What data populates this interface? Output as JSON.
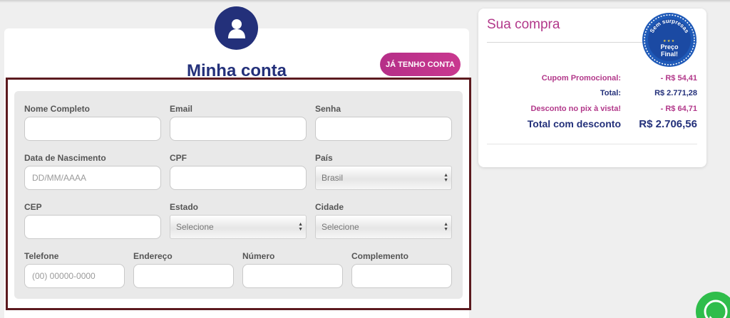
{
  "account": {
    "title": "Minha conta",
    "have_account_button": "JÁ TENHO CONTA"
  },
  "form": {
    "full_name_label": "Nome Completo",
    "email_label": "Email",
    "password_label": "Senha",
    "birthdate_label": "Data de Nascimento",
    "birthdate_placeholder": "DD/MM/AAAA",
    "cpf_label": "CPF",
    "country_label": "País",
    "country_value": "Brasil",
    "cep_label": "CEP",
    "state_label": "Estado",
    "state_value": "Selecione",
    "city_label": "Cidade",
    "city_value": "Selecione",
    "phone_label": "Telefone",
    "phone_placeholder": "(00) 00000-0000",
    "address_label": "Endereço",
    "number_label": "Número",
    "complement_label": "Complemento"
  },
  "purchase": {
    "title": "Sua compra",
    "seal_top": "Sem surpresas",
    "seal_middle": "Preço",
    "seal_bottom": "Final!",
    "coupon_label": "Cupom Promocional:",
    "coupon_value": "- R$ 54,41",
    "total_label": "Total:",
    "total_value": "R$ 2.771,28",
    "pix_label": "Desconto no pix à vista!",
    "pix_value": "- R$ 64,71",
    "final_label": "Total com desconto",
    "final_value": "R$ 2.706,56"
  },
  "colors": {
    "navy": "#23307a",
    "pink": "#b2388a",
    "frame": "#5c1a1f",
    "whatsapp": "#2fbd4b"
  },
  "icons": [
    "user-icon",
    "whatsapp-icon"
  ]
}
